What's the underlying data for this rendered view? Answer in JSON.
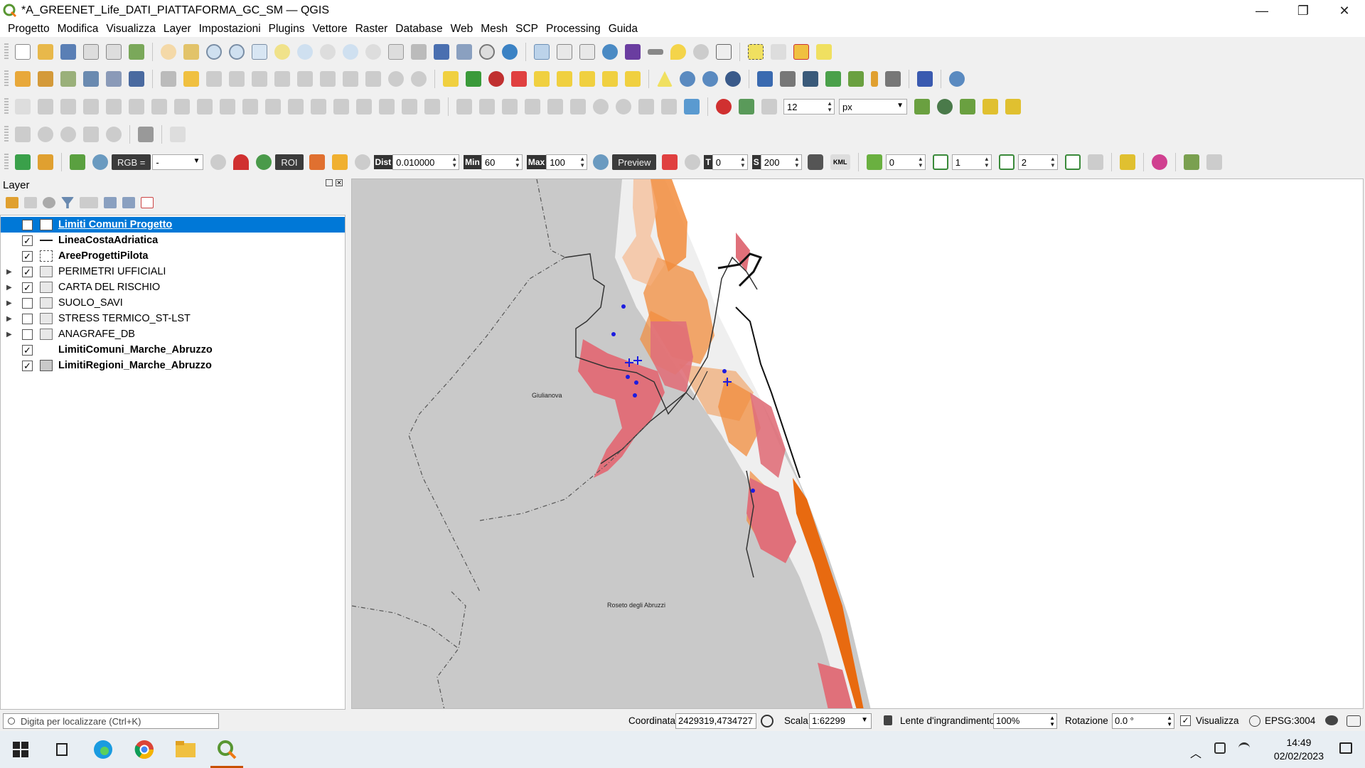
{
  "window": {
    "title": "*A_GREENET_Life_DATI_PIATTAFORMA_GC_SM — QGIS",
    "minimize": "—",
    "maximize": "❐",
    "close": "✕"
  },
  "menu": [
    "Progetto",
    "Modifica",
    "Visualizza",
    "Layer",
    "Impostazioni",
    "Plugins",
    "Vettore",
    "Raster",
    "Database",
    "Web",
    "Mesh",
    "SCP",
    "Processing",
    "Guida"
  ],
  "toolbar": {
    "snap_tolerance": "12",
    "snap_units": "px",
    "rgb_label": "RGB =",
    "rgb_value": "-",
    "roi_label": "ROI",
    "dist_label": "Dist",
    "dist_value": "0.010000",
    "min_label": "Min",
    "min_value": "60",
    "max_label": "Max",
    "max_value": "100",
    "preview_label": "Preview",
    "t_label": "T",
    "t_value": "0",
    "s_label": "S",
    "s_value": "200",
    "kml_label": "KML",
    "band_a": "0",
    "band_b": "1",
    "band_c": "2"
  },
  "layers_panel": {
    "title": "Layer",
    "items": [
      {
        "label": "Limiti Comuni Progetto",
        "checked": "✓",
        "bold": true,
        "selected": true,
        "expandable": false,
        "symbol": "fill-white"
      },
      {
        "label": "LineaCostaAdriatica",
        "checked": "✓",
        "bold": true,
        "selected": false,
        "expandable": false,
        "symbol": "line"
      },
      {
        "label": "AreeProgettiPilota",
        "checked": "✓",
        "bold": true,
        "selected": false,
        "expandable": false,
        "symbol": "dashed"
      },
      {
        "label": "PERIMETRI UFFICIALI",
        "checked": "✓",
        "bold": false,
        "selected": false,
        "expandable": true,
        "symbol": "group"
      },
      {
        "label": "CARTA DEL RISCHIO",
        "checked": "✓",
        "bold": false,
        "selected": false,
        "expandable": true,
        "symbol": "group"
      },
      {
        "label": "SUOLO_SAVI",
        "checked": "",
        "bold": false,
        "selected": false,
        "expandable": true,
        "symbol": "group"
      },
      {
        "label": "STRESS TERMICO_ST-LST",
        "checked": "",
        "bold": false,
        "selected": false,
        "expandable": true,
        "symbol": "group"
      },
      {
        "label": "ANAGRAFE_DB",
        "checked": "",
        "bold": false,
        "selected": false,
        "expandable": true,
        "symbol": "group"
      },
      {
        "label": "LimitiComuni_Marche_Abruzzo",
        "checked": "✓",
        "bold": true,
        "selected": false,
        "expandable": false,
        "symbol": "none"
      },
      {
        "label": "LimitiRegioni_Marche_Abruzzo",
        "checked": "✓",
        "bold": true,
        "selected": false,
        "expandable": false,
        "symbol": "fill-grey"
      }
    ]
  },
  "map": {
    "labels": [
      "Giulianova",
      "Roseto degli Abruzzi"
    ],
    "colors": {
      "land": "#c8c8c8",
      "risk_high": "#e0707a",
      "risk_orange": "#f28c3c",
      "coast": "#e86a10",
      "points": "#1c1ce0"
    }
  },
  "statusbar": {
    "search_placeholder": "Digita per localizzare (Ctrl+K)",
    "coord_label": "Coordinata",
    "coord_value": "2429319,4734727",
    "scale_label": "Scala",
    "scale_value": "1:62299",
    "magnifier_label": "Lente d'ingrandimento",
    "magnifier_value": "100%",
    "rotation_label": "Rotazione",
    "rotation_value": "0.0 °",
    "render_label": "Visualizza",
    "crs": "EPSG:3004"
  },
  "taskbar": {
    "time": "14:49",
    "date": "02/02/2023"
  }
}
